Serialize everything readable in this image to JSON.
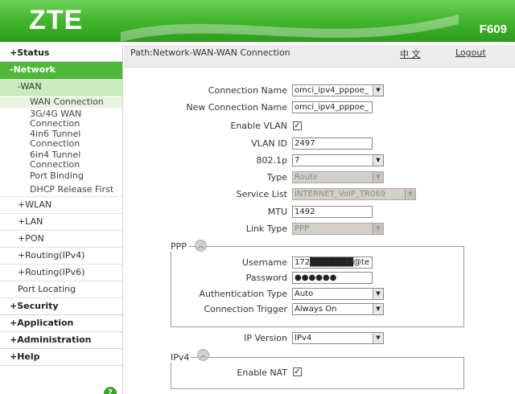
{
  "header": {
    "logo": "ZTE",
    "model": "F609"
  },
  "sidebar": {
    "status": "+Status",
    "network": "-Network",
    "wan": "-WAN",
    "wan_items": [
      "WAN Connection",
      "3G/4G WAN Connection",
      "4in6 Tunnel Connection",
      "6in4 Tunnel Connection",
      "Port Binding",
      "DHCP Release First"
    ],
    "wlan": "+WLAN",
    "lan": "+LAN",
    "pon": "+PON",
    "routing_v4": "+Routing(IPv4)",
    "routing_v6": "+Routing(IPv6)",
    "port_locating": "Port Locating",
    "security": "+Security",
    "application": "+Application",
    "administration": "+Administration",
    "help": "+Help",
    "help_icon": "?"
  },
  "pathbar": {
    "path": "Path:Network-WAN-WAN Connection",
    "lang": "中 文",
    "logout": "Logout"
  },
  "form": {
    "connection_name_label": "Connection Name",
    "connection_name_value": "omci_ipv4_pppoe_",
    "new_connection_name_label": "New Connection Name",
    "new_connection_name_value": "omci_ipv4_pppoe_",
    "enable_vlan_label": "Enable VLAN",
    "enable_vlan_checked": "✓",
    "vlan_id_label": "VLAN ID",
    "vlan_id_value": "2497",
    "p8021_label": "802.1p",
    "p8021_value": "7",
    "type_label": "Type",
    "type_value": "Route",
    "service_list_label": "Service List",
    "service_list_value": "INTERNET_VoIP_TR069",
    "mtu_label": "MTU",
    "mtu_value": "1492",
    "link_type_label": "Link Type",
    "link_type_value": "PPP",
    "ppp_title": "PPP",
    "username_label": "Username",
    "username_value": "172███████@te",
    "password_label": "Password",
    "password_value": "●●●●●●",
    "auth_type_label": "Authentication Type",
    "auth_type_value": "Auto",
    "conn_trigger_label": "Connection Trigger",
    "conn_trigger_value": "Always On",
    "ip_version_label": "IP Version",
    "ip_version_value": "IPv4",
    "ipv4_title": "IPv4",
    "enable_nat_label": "Enable NAT",
    "enable_nat_checked": "✓"
  },
  "colors": {
    "header_green": "#46b82f",
    "nav_active": "#4fb83a",
    "nav_sub_active": "#c9ebbd",
    "disabled_field": "#d4d0c8"
  }
}
